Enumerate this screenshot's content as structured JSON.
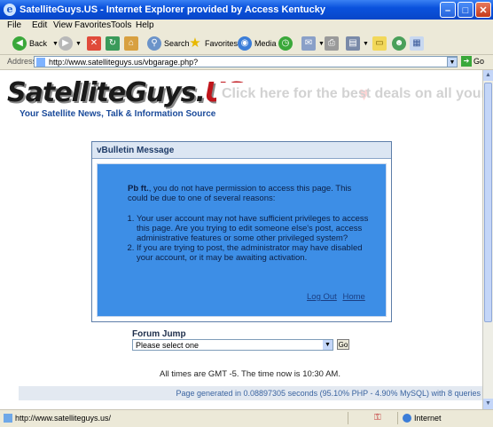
{
  "window": {
    "title": "SatelliteGuys.US - Internet Explorer provided by Access Kentucky"
  },
  "menu": [
    "File",
    "Edit",
    "View",
    "Favorites",
    "Tools",
    "Help"
  ],
  "toolbar": {
    "back": "Back",
    "search": "Search",
    "favorites": "Favorites",
    "media": "Media"
  },
  "address": {
    "label": "Address",
    "url": "http://www.satelliteguys.us/vbgarage.php?",
    "go": "Go"
  },
  "logo": {
    "main": "SatelliteGuys.",
    "main_suffix": "US",
    "tagline": "Your Satellite News, Talk & Information Source"
  },
  "banner": {
    "text": "Click here for the best deals on all your"
  },
  "message": {
    "header": "vBulletin Message",
    "user": "Pb ft.",
    "intro": ", you do not have permission to access this page. This could be due to one of several reasons:",
    "reasons": [
      "Your user account may not have sufficient privileges to access this page. Are you trying to edit someone else's post, access administrative features or some other privileged system?",
      "If you are trying to post, the administrator may have disabled your account, or it may be awaiting activation."
    ],
    "logout": "Log Out",
    "home": "Home"
  },
  "forum_jump": {
    "label": "Forum Jump",
    "selected": "Please select one",
    "go": "Go"
  },
  "footer": {
    "times": "All times are GMT -5. The time now is 10:30 AM.",
    "generated": "Page generated in 0.08897305 seconds (95.10% PHP - 4.90% MySQL) with 8 queries"
  },
  "status": {
    "text": "http://www.satelliteguys.us/",
    "zone": "Internet"
  }
}
